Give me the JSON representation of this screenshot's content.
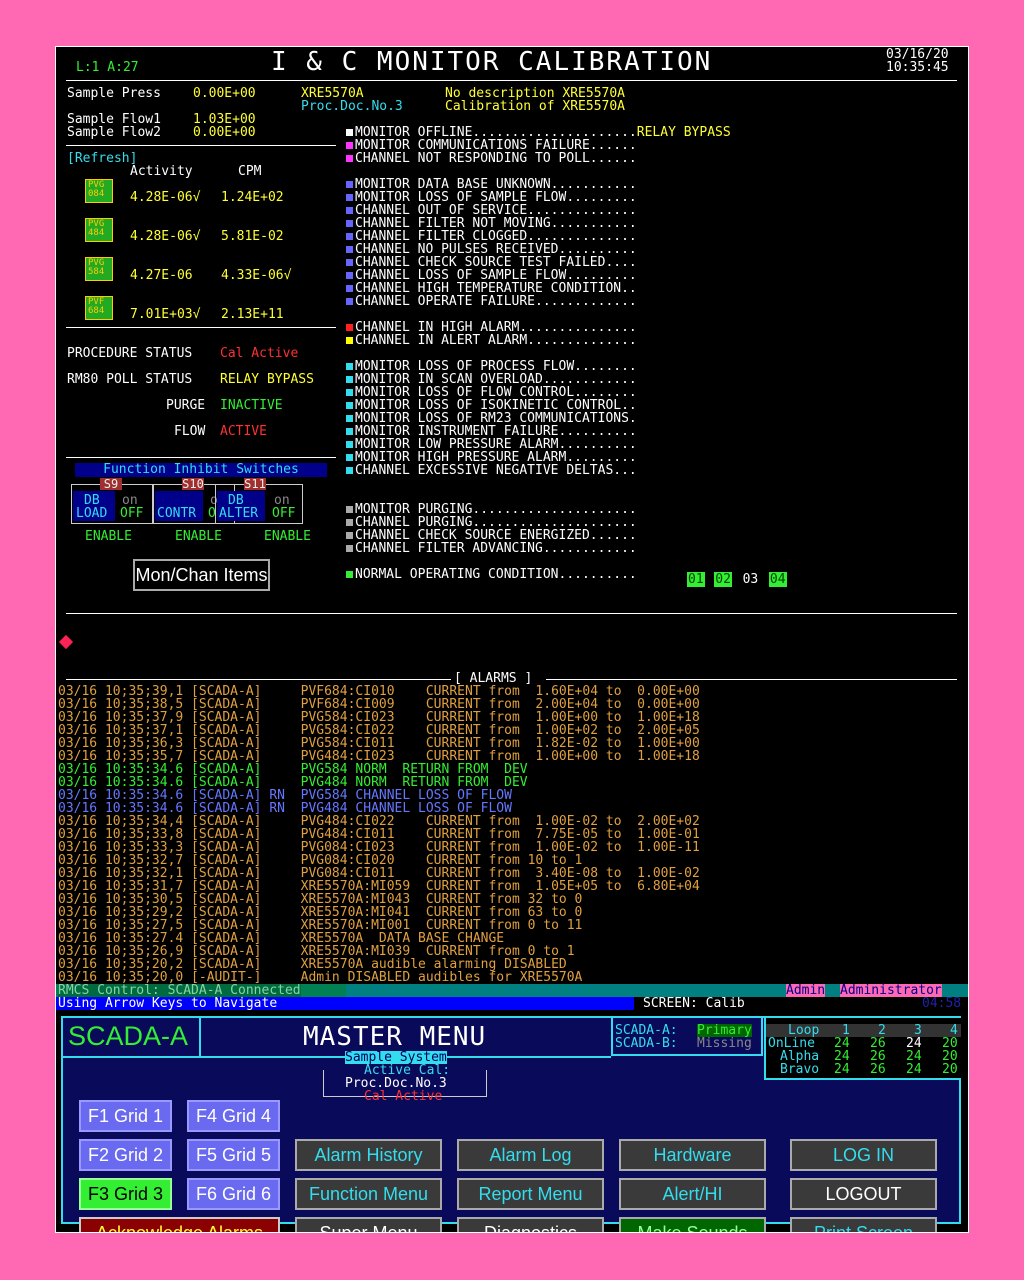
{
  "header": {
    "level": "L:1 A:27",
    "title": "I & C MONITOR CALIBRATION",
    "date": "03/16/20",
    "time": "10:35:45"
  },
  "samples": {
    "press_label": "Sample Press",
    "press_value": "0.00E+00",
    "flow1_label": "Sample Flow1",
    "flow1_value": "1.03E+00",
    "flow2_label": "Sample Flow2",
    "flow2_value": "0.00E+00"
  },
  "monitor_info": {
    "id": "XRE5570A",
    "desc": "No description XRE5570A",
    "proc": "Proc.Doc.No.3",
    "cal": "Calibration of XRE5570A"
  },
  "refresh": {
    "label": "[Refresh]",
    "col_activity": "Activity",
    "col_cpm": "CPM"
  },
  "channels": [
    {
      "icon": "PVG 084",
      "activity": "4.28E-06√",
      "cpm": "1.24E+02"
    },
    {
      "icon": "PVG 484",
      "activity": "4.28E-06√",
      "cpm": "5.81E-02"
    },
    {
      "icon": "PVG 584",
      "activity": "4.27E-06 ",
      "cpm": "4.33E-06√"
    },
    {
      "icon": "PVF 684",
      "activity": "7.01E+03√",
      "cpm": "2.13E+11"
    }
  ],
  "status": {
    "procedure_label": "PROCEDURE STATUS",
    "procedure_value": "Cal Active",
    "poll_label": "RM80 POLL STATUS",
    "poll_value": "RELAY BYPASS",
    "purge_label": "PURGE",
    "purge_value": "INACTIVE",
    "flow_label": "FLOW",
    "flow_value": "ACTIVE"
  },
  "inhibit": {
    "title": "Function Inhibit Switches",
    "switches": [
      {
        "tag": "S9",
        "l1": "DB",
        "l2": "LOAD",
        "on": "on",
        "off": "OFF",
        "enable": "ENABLE"
      },
      {
        "tag": "S10",
        "l1": "",
        "l2": "CONTR",
        "on": "on",
        "off": "OFF",
        "enable": "ENABLE"
      },
      {
        "tag": "S11",
        "l1": "DB",
        "l2": "ALTER",
        "on": "on",
        "off": "OFF",
        "enable": "ENABLE"
      }
    ],
    "mon_chan_button": "Mon/Chan Items"
  },
  "status_list": [
    {
      "text": "MONITOR OFFLINE.....................",
      "suffix": "RELAY BYPASS",
      "color": "#ffffff"
    },
    {
      "text": "MONITOR COMMUNICATIONS FAILURE......",
      "suffix": "",
      "color": "#ff33ff"
    },
    {
      "text": "CHANNEL NOT RESPONDING TO POLL......",
      "suffix": "",
      "color": "#ff33ff"
    },
    {
      "text": "",
      "suffix": "",
      "color": ""
    },
    {
      "text": "MONITOR DATA BASE UNKNOWN...........",
      "suffix": "",
      "color": "#6666ff"
    },
    {
      "text": "MONITOR LOSS OF SAMPLE FLOW.........",
      "suffix": "",
      "color": "#6666ff"
    },
    {
      "text": "CHANNEL OUT OF SERVICE..............",
      "suffix": "",
      "color": "#6666ff"
    },
    {
      "text": "CHANNEL FILTER NOT MOVING...........",
      "suffix": "",
      "color": "#6666ff"
    },
    {
      "text": "CHANNEL FILTER CLOGGED..............",
      "suffix": "",
      "color": "#6666ff"
    },
    {
      "text": "CHANNEL NO PULSES RECEIVED..........",
      "suffix": "",
      "color": "#6666ff"
    },
    {
      "text": "CHANNEL CHECK SOURCE TEST FAILED....",
      "suffix": "",
      "color": "#6666ff"
    },
    {
      "text": "CHANNEL LOSS OF SAMPLE FLOW.........",
      "suffix": "",
      "color": "#6666ff"
    },
    {
      "text": "CHANNEL HIGH TEMPERATURE CONDITION..",
      "suffix": "",
      "color": "#6666ff"
    },
    {
      "text": "CHANNEL OPERATE FAILURE.............",
      "suffix": "",
      "color": "#6666ff"
    },
    {
      "text": "",
      "suffix": "",
      "color": ""
    },
    {
      "text": "CHANNEL IN HIGH ALARM...............",
      "suffix": "",
      "color": "#ff2020"
    },
    {
      "text": "CHANNEL IN ALERT ALARM..............",
      "suffix": "",
      "color": "#ffff00"
    },
    {
      "text": "",
      "suffix": "",
      "color": ""
    },
    {
      "text": "MONITOR LOSS OF PROCESS FLOW........",
      "suffix": "",
      "color": "#33ddee"
    },
    {
      "text": "MONITOR IN SCAN OVERLOAD............",
      "suffix": "",
      "color": "#33ddee"
    },
    {
      "text": "MONITOR LOSS OF FLOW CONTROL........",
      "suffix": "",
      "color": "#33ddee"
    },
    {
      "text": "MONITOR LOSS OF ISOKINETIC CONTROL..",
      "suffix": "",
      "color": "#33ddee"
    },
    {
      "text": "MONITOR LOSS OF RM23 COMMUNICATIONS.",
      "suffix": "",
      "color": "#33ddee"
    },
    {
      "text": "MONITOR INSTRUMENT FAILURE..........",
      "suffix": "",
      "color": "#33ddee"
    },
    {
      "text": "MONITOR LOW PRESSURE ALARM..........",
      "suffix": "",
      "color": "#33ddee"
    },
    {
      "text": "MONITOR HIGH PRESSURE ALARM.........",
      "suffix": "",
      "color": "#33ddee"
    },
    {
      "text": "CHANNEL EXCESSIVE NEGATIVE DELTAS...",
      "suffix": "",
      "color": "#33ddee"
    },
    {
      "text": "",
      "suffix": "",
      "color": ""
    },
    {
      "text": "",
      "suffix": "",
      "color": ""
    },
    {
      "text": "MONITOR PURGING.....................",
      "suffix": "",
      "color": "#aaaaaa"
    },
    {
      "text": "CHANNEL PURGING.....................",
      "suffix": "",
      "color": "#aaaaaa"
    },
    {
      "text": "CHANNEL CHECK SOURCE ENERGIZED......",
      "suffix": "",
      "color": "#aaaaaa"
    },
    {
      "text": "CHANNEL FILTER ADVANCING............",
      "suffix": "",
      "color": "#aaaaaa"
    },
    {
      "text": "",
      "suffix": "",
      "color": ""
    },
    {
      "text": "NORMAL OPERATING CONDITION..........",
      "suffix": "",
      "color": "#33ee33"
    }
  ],
  "normal_channels": [
    "01",
    "02",
    "03",
    "04"
  ],
  "alarms_header": "[ ALARMS ]",
  "alarms": [
    {
      "text": "03/16 10;35;39,1 [SCADA-A]     PVF684:CI010    CURRENT from  1.60E+04 to  0.00E+00",
      "color": "#e0a040"
    },
    {
      "text": "03/16 10;35;38,5 [SCADA-A]     PVF684:CI009    CURRENT from  2.00E+04 to  0.00E+00",
      "color": "#e0a040"
    },
    {
      "text": "03/16 10;35;37,9 [SCADA-A]     PVG584:CI023    CURRENT from  1.00E+00 to  1.00E+18",
      "color": "#e0a040"
    },
    {
      "text": "03/16 10;35;37,1 [SCADA-A]     PVG584:CI022    CURRENT from  1.00E+02 to  2.00E+05",
      "color": "#e0a040"
    },
    {
      "text": "03/16 10;35;36,3 [SCADA-A]     PVG584:CI011    CURRENT from  1.82E-02 to  1.00E+00",
      "color": "#e0a040"
    },
    {
      "text": "03/16 10;35;35,7 [SCADA-A]     PVG484:CI023    CURRENT from  1.00E+00 to  1.00E+18",
      "color": "#e0a040"
    },
    {
      "text": "03/16 10:35:34.6 [SCADA-A]     PVG584 NORM  RETURN FROM  DEV",
      "color": "#33ee33"
    },
    {
      "text": "03/16 10:35:34.6 [SCADA-A]     PVG484 NORM  RETURN FROM  DEV",
      "color": "#33ee33"
    },
    {
      "text": "03/16 10:35:34.6 [SCADA-A] RN  PVG584 CHANNEL LOSS OF FLOW",
      "color": "#6677ff"
    },
    {
      "text": "03/16 10:35:34.6 [SCADA-A] RN  PVG484 CHANNEL LOSS OF FLOW",
      "color": "#6677ff"
    },
    {
      "text": "03/16 10;35;34,4 [SCADA-A]     PVG484:CI022    CURRENT from  1.00E-02 to  2.00E+02",
      "color": "#e0a040"
    },
    {
      "text": "03/16 10;35;33,8 [SCADA-A]     PVG484:CI011    CURRENT from  7.75E-05 to  1.00E-01",
      "color": "#e0a040"
    },
    {
      "text": "03/16 10;35;33,3 [SCADA-A]     PVG084:CI023    CURRENT from  1.00E-02 to  1.00E-11",
      "color": "#e0a040"
    },
    {
      "text": "03/16 10;35;32,7 [SCADA-A]     PVG084:CI020    CURRENT from 10 to 1",
      "color": "#e0a040"
    },
    {
      "text": "03/16 10;35;32,1 [SCADA-A]     PVG084:CI011    CURRENT from  3.40E-08 to  1.00E-02",
      "color": "#e0a040"
    },
    {
      "text": "03/16 10;35;31,7 [SCADA-A]     XRE5570A:MI059  CURRENT from  1.05E+05 to  6.80E+04",
      "color": "#e0a040"
    },
    {
      "text": "03/16 10;35;30,5 [SCADA-A]     XRE5570A:MI043  CURRENT from 32 to 0",
      "color": "#e0a040"
    },
    {
      "text": "03/16 10;35;29,2 [SCADA-A]     XRE5570A:MI041  CURRENT from 63 to 0",
      "color": "#e0a040"
    },
    {
      "text": "03/16 10;35;27,5 [SCADA-A]     XRE5570A:MI001  CURRENT from 0 to 11",
      "color": "#e0a040"
    },
    {
      "text": "03/16 10:35:27.4 [SCADA-A]     XRE5570A  DATA BASE CHANGE",
      "color": "#e0a040"
    },
    {
      "text": "03/16 10;35;26,9 [SCADA-A]     XRE5570A:MI039  CURRENT from 0 to 1",
      "color": "#e0a040"
    },
    {
      "text": "03/16 10;35;20,2 [SCADA-A]     XRE5570A audible alarming DISABLED",
      "color": "#e0a040"
    },
    {
      "text": "03/16 10;35;20,0 [-AUDIT-]     Admin DISABLED audibles for XRE5570A",
      "color": "#e0a040"
    }
  ],
  "statusbar": {
    "rmcs": "RMCS Control: SCADA-A Connected",
    "role": "Admin",
    "user": "Administrator",
    "nav_hint": "Using Arrow Keys to Navigate",
    "screen": "SCREEN: Calib",
    "clock": "04:58"
  },
  "master": {
    "site": "SCADA-A",
    "title": "MASTER MENU",
    "scada_a_label": "SCADA-A:",
    "scada_a_value": "Primary",
    "scada_b_label": "SCADA-B:",
    "scada_b_value": "Missing",
    "loop_table": {
      "headers": [
        "Loop",
        "1",
        "2",
        "3",
        "4"
      ],
      "rows": [
        [
          "OnLine",
          "24",
          "26",
          "24",
          "20"
        ],
        [
          "Alpha",
          "24",
          "26",
          "24",
          "20"
        ],
        [
          "Bravo",
          "24",
          "26",
          "24",
          "20"
        ]
      ]
    },
    "sample_system": "Sample System",
    "active_cal_label": "Active Cal:",
    "active_cal_value": "Proc.Doc.No.3",
    "active_cal_status": "Cal Active",
    "grid_buttons": [
      "F1 Grid 1",
      "F4 Grid 4",
      "F2 Grid 2",
      "F5 Grid 5",
      "F3 Grid 3",
      "F6 Grid 6"
    ],
    "ack_button": "Acknowledge  Alarms",
    "buttons": {
      "alarm_history": "Alarm History",
      "alarm_log": "Alarm Log",
      "hardware": "Hardware",
      "login": "LOG IN",
      "function_menu": "Function Menu",
      "report_menu": "Report Menu",
      "alert_hi": "Alert/HI",
      "logout": "LOGOUT",
      "super_menu": "Super Menu",
      "diagnostics": "Diagnostics",
      "make_sounds": "Make Sounds",
      "print_screen": "Print Screen"
    }
  }
}
